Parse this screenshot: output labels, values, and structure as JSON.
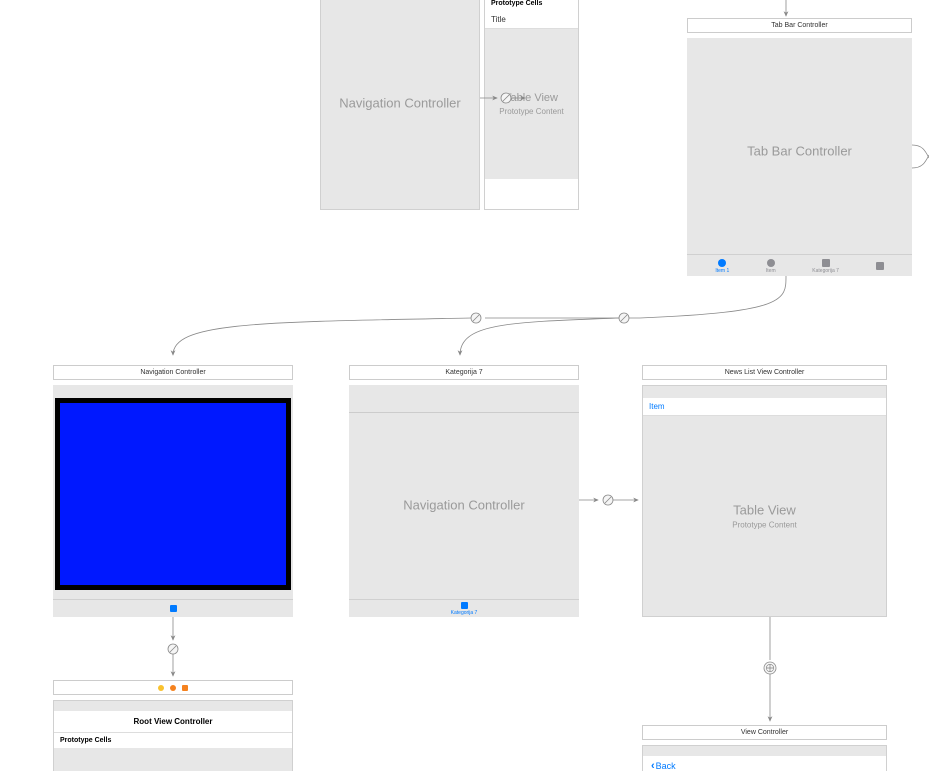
{
  "top_nav": {
    "title": "Navigation Controller",
    "body_text": "Navigation Controller"
  },
  "top_table": {
    "proto_header": "Prototype Cells",
    "row_title": "Title",
    "body_title": "Table View",
    "body_sub": "Prototype Content"
  },
  "top_tab": {
    "title": "Tab Bar Controller",
    "body_text": "Tab Bar Controller",
    "items": [
      {
        "label": "Item 1",
        "active": true,
        "shape": "circle"
      },
      {
        "label": "Item",
        "active": false,
        "shape": "circle"
      },
      {
        "label": "Kategorija 7",
        "active": false,
        "shape": "square"
      },
      {
        "label": "",
        "active": false,
        "shape": "square"
      }
    ]
  },
  "mid_nav_left": {
    "title": "Navigation Controller"
  },
  "mid_nav_center": {
    "title": "Kategorija 7",
    "body_text": "Navigation Controller",
    "tab_label": "Kategorija 7"
  },
  "mid_news": {
    "title": "News List View Controller",
    "item_label": "Item",
    "body_title": "Table View",
    "body_sub": "Prototype Content"
  },
  "root_vc": {
    "title": "Root View Controller",
    "proto_header": "Prototype Cells"
  },
  "bottom_vc": {
    "title": "View Controller",
    "back_label": "Back"
  }
}
